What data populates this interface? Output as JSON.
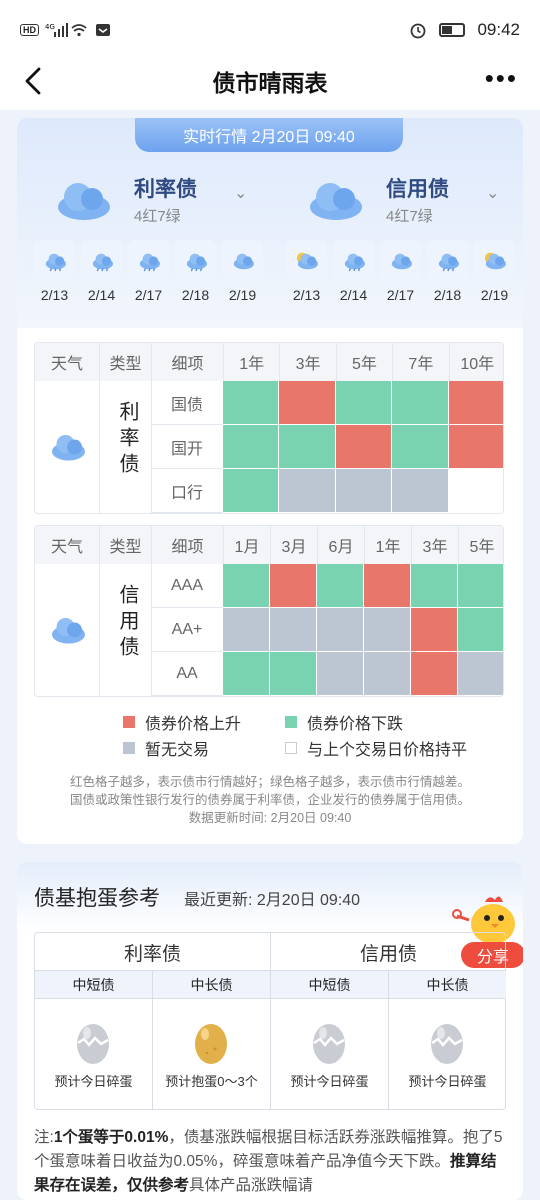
{
  "status": {
    "left_icons": "HD 4G signal wifi 6G",
    "time": "09:42"
  },
  "nav": {
    "title": "债市晴雨表",
    "more": "•••"
  },
  "realtime": {
    "label": "实时行情 2月20日 09:40"
  },
  "categories": [
    {
      "name": "利率债",
      "count": "4红7绿",
      "days": [
        "2/13",
        "2/14",
        "2/17",
        "2/18",
        "2/19"
      ],
      "icons": [
        "rain",
        "rain",
        "rain",
        "rain",
        "cloud"
      ]
    },
    {
      "name": "信用债",
      "count": "4红7绿",
      "days": [
        "2/13",
        "2/14",
        "2/17",
        "2/18",
        "2/19"
      ],
      "icons": [
        "sun-cloud",
        "rain",
        "cloud",
        "rain",
        "sun-cloud"
      ]
    }
  ],
  "rate_grid": {
    "h_weather": "天气",
    "h_type": "类型",
    "h_item": "细项",
    "cols": [
      "1年",
      "3年",
      "5年",
      "7年",
      "10年"
    ],
    "type_label": "利率债",
    "rows": [
      {
        "label": "国债",
        "cells": [
          "g",
          "r",
          "g",
          "g",
          "r"
        ]
      },
      {
        "label": "国开",
        "cells": [
          "g",
          "g",
          "r",
          "g",
          "r"
        ]
      },
      {
        "label": "口行",
        "cells": [
          "g",
          "n",
          "n",
          "n",
          "w"
        ]
      }
    ]
  },
  "credit_grid": {
    "h_weather": "天气",
    "h_type": "类型",
    "h_item": "细项",
    "cols": [
      "1月",
      "3月",
      "6月",
      "1年",
      "3年",
      "5年"
    ],
    "type_label": "信用债",
    "rows": [
      {
        "label": "AAA",
        "cells": [
          "g",
          "r",
          "g",
          "r",
          "g",
          "g"
        ]
      },
      {
        "label": "AA+",
        "cells": [
          "n",
          "n",
          "n",
          "n",
          "r",
          "g"
        ]
      },
      {
        "label": "AA",
        "cells": [
          "g",
          "g",
          "n",
          "n",
          "r",
          "n"
        ]
      }
    ]
  },
  "legend": {
    "up": "债券价格上升",
    "down": "债券价格下跌",
    "none": "暂无交易",
    "flat": "与上个交易日价格持平"
  },
  "notes": {
    "line1": "红色格子越多，表示债市行情越好；绿色格子越多，表示债市行情越差。",
    "line2": "国债或政策性银行发行的债券属于利率债，企业发行的债券属于信用债。",
    "line3": "数据更新时间:   2月20日 09:40"
  },
  "egg": {
    "title": "债基抱蛋参考",
    "update": "最近更新:   2月20日 09:40",
    "share": "分享",
    "groups": [
      "利率债",
      "信用债"
    ],
    "subs": [
      "中短债",
      "中长债",
      "中短债",
      "中长债"
    ],
    "predictions": [
      "预计今日碎蛋",
      "预计抱蛋0～3个",
      "预计今日碎蛋",
      "预计今日碎蛋"
    ],
    "foot_a": "注:",
    "foot_b": "1个蛋等于0.01%",
    "foot_c": "，债基涨跌幅根据目标活跃券涨跌幅推算。抱了5个蛋意味着日收益为0.05%，碎蛋意味着产品净值今天下跌。",
    "foot_d": "推算结果存在误差，仅供参考",
    "foot_e": "具体产品涨跌幅请"
  },
  "colors": {
    "red": "#e8766a",
    "green": "#79d2b0",
    "gray": "#bcc6d3",
    "white": "#ffffff"
  }
}
